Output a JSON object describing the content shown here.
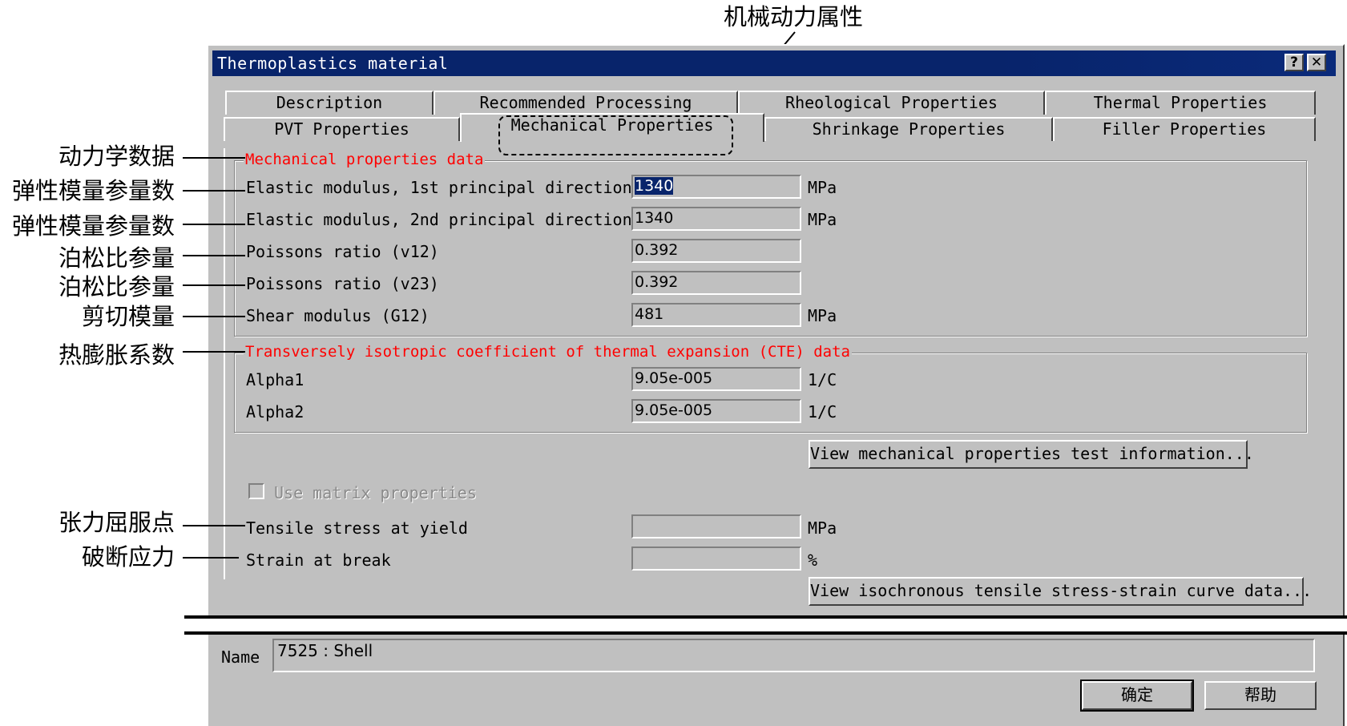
{
  "annotations": {
    "top": "机械动力属性",
    "left": [
      "动力学数据",
      "弹性模量参量数",
      "弹性模量参量数",
      "泊松比参量",
      "泊松比参量",
      "剪切模量",
      "热膨胀系数",
      "张力屈服点",
      "破断应力"
    ]
  },
  "window": {
    "title": "Thermoplastics material",
    "help_glyph": "?",
    "close_glyph": "✕"
  },
  "tabs": {
    "row1": [
      "Description",
      "Recommended Processing",
      "Rheological Properties",
      "Thermal Properties"
    ],
    "row2": [
      "PVT Properties",
      "Mechanical Properties",
      "Shrinkage Properties",
      "Filler Properties"
    ],
    "active": "Mechanical Properties"
  },
  "mechanical": {
    "group_title": "Mechanical properties data",
    "rows": [
      {
        "label": "Elastic modulus, 1st principal direction",
        "value": "1340",
        "unit": "MPa"
      },
      {
        "label": "Elastic modulus, 2nd principal direction",
        "value": "1340",
        "unit": "MPa"
      },
      {
        "label": "Poissons ratio (v12)",
        "value": "0.392",
        "unit": ""
      },
      {
        "label": "Poissons ratio (v23)",
        "value": "0.392",
        "unit": ""
      },
      {
        "label": "Shear modulus (G12)",
        "value": "481",
        "unit": "MPa"
      }
    ]
  },
  "cte": {
    "group_title": "Transversely isotropic coefficient of thermal expansion (CTE) data",
    "rows": [
      {
        "label": "Alpha1",
        "value": "9.05e-005",
        "unit": "1/C"
      },
      {
        "label": "Alpha2",
        "value": "9.05e-005",
        "unit": "1/C"
      }
    ]
  },
  "buttons": {
    "view_test_info": "View mechanical properties test information...",
    "view_curve": "View isochronous tensile stress-strain curve data...",
    "ok": "确定",
    "help": "帮助"
  },
  "matrix_checkbox": {
    "label": "Use matrix properties",
    "checked": false,
    "enabled": false
  },
  "tensile": {
    "rows": [
      {
        "label": "Tensile stress at yield",
        "value": "",
        "unit": "MPa"
      },
      {
        "label": "Strain at break",
        "value": "",
        "unit": "%"
      }
    ]
  },
  "name": {
    "label": "Name",
    "value": "7525 : Shell"
  },
  "colors": {
    "titlebar": "#08246b",
    "face": "#c0c0c0",
    "group_title": "#ff0000"
  }
}
